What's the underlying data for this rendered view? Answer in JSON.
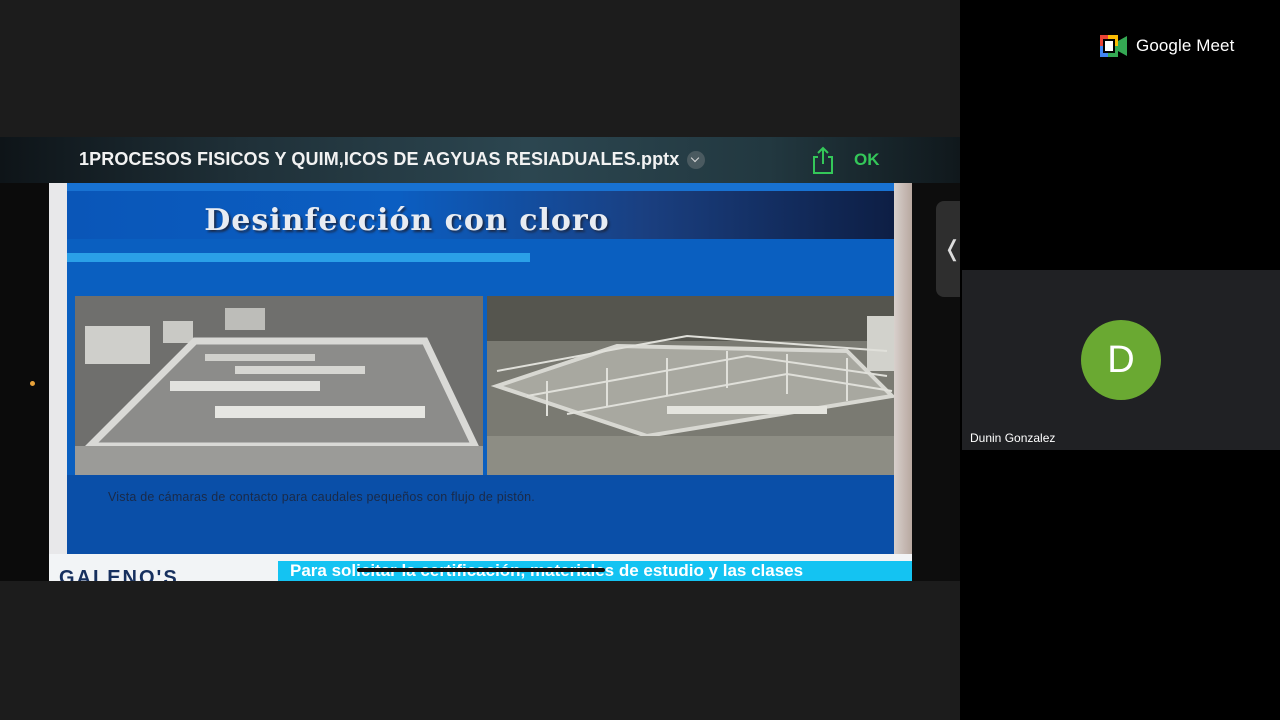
{
  "app": {
    "name": "Google Meet"
  },
  "presentation": {
    "file_title": "1PROCESOS FISICOS Y QUIM,ICOS DE AGYUAS RESIADUALES.pptx",
    "ok_label": "OK",
    "slide": {
      "title": "Desinfección con cloro",
      "caption": "Vista de cámaras de contacto para caudales pequeños con flujo de pistón.",
      "logo_text": "GALENO'S",
      "banner_text": "Para solicitar la certificación, materiales de estudio y las clases"
    }
  },
  "participant": {
    "initial": "D",
    "name": "Dunin Gonzalez",
    "avatar_color": "#6aa932"
  },
  "icons": {
    "share": "share-icon",
    "chevron": "chevron-down-icon",
    "side": "chevron-left-icon"
  },
  "colors": {
    "ok": "#34c759",
    "slide_blue": "#0a5fc0",
    "banner": "#14c3f2"
  }
}
